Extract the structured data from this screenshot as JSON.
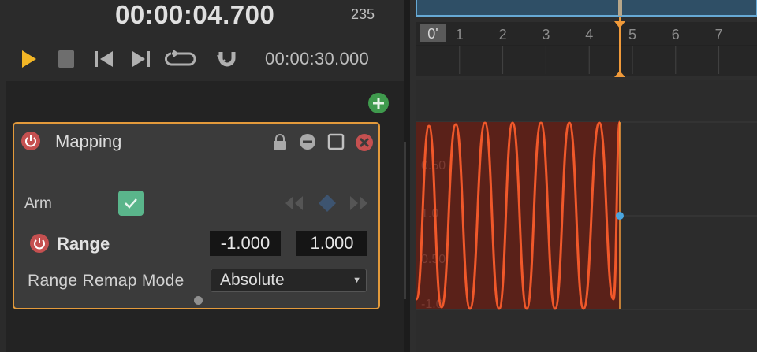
{
  "transport": {
    "current_time": "00:00:04.700",
    "frame": "235",
    "total_time": "00:00:30.000"
  },
  "ruler": {
    "start_label": "0'",
    "tick_labels": [
      "1",
      "2",
      "3",
      "4",
      "5",
      "6",
      "7"
    ]
  },
  "mapping": {
    "title": "Mapping",
    "arm_label": "Arm",
    "arm_checked": true,
    "range_label": "Range",
    "range_min": "-1.000",
    "range_max": "1.000",
    "remap_mode_label": "Range Remap Mode",
    "remap_mode_value": "Absolute"
  },
  "curve": {
    "y_labels": [
      "0.50",
      "1.0",
      "0.50",
      "-1.0"
    ],
    "colors": {
      "fill": "#5a2119",
      "line": "#f0582a",
      "cursor": "#f09a3a",
      "key": "#4aa6e0"
    }
  }
}
